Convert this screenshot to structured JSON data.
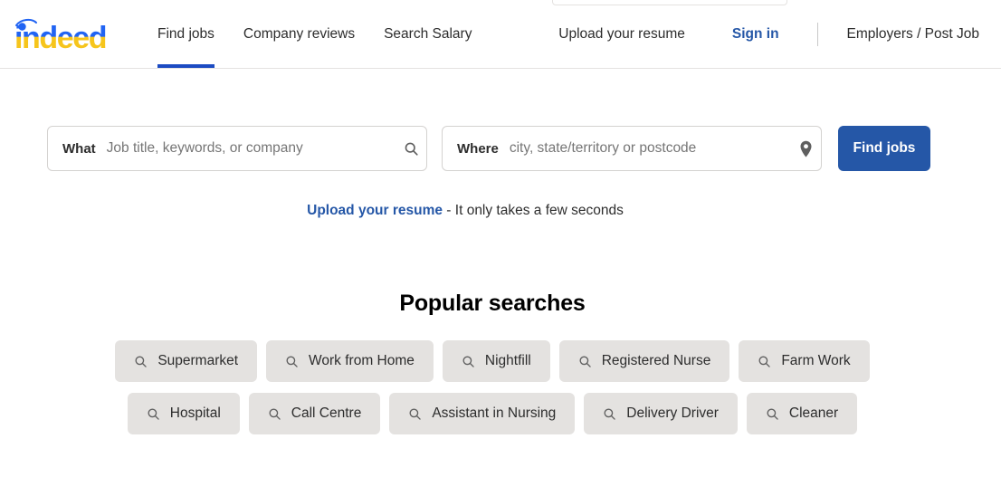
{
  "brand": {
    "logo_text": "indeed",
    "logo_blue": "#2164f3",
    "logo_yellow": "#f6c51c"
  },
  "header": {
    "nav_primary": [
      {
        "label": "Find jobs",
        "active": true
      },
      {
        "label": "Company reviews",
        "active": false
      },
      {
        "label": "Search Salary",
        "active": false
      }
    ],
    "upload_resume": "Upload your resume",
    "sign_in": "Sign in",
    "employers": "Employers / Post Job",
    "accent_color": "#2557a7",
    "active_underline_color": "#1c4bc2"
  },
  "search": {
    "what_label": "What",
    "what_placeholder": "Job title, keywords, or company",
    "what_value": "",
    "what_icon": "search-icon",
    "where_label": "Where",
    "where_placeholder": "city, state/territory or postcode",
    "where_value": "",
    "where_icon": "location-pin-icon",
    "find_jobs_button": "Find jobs",
    "button_color": "#2557a7"
  },
  "resume_promo": {
    "link_text": "Upload your resume",
    "rest_text": " - It only takes a few seconds"
  },
  "popular_searches": {
    "title": "Popular searches",
    "chip_icon": "search-icon",
    "chip_color": "#e4e2e0",
    "row1": [
      {
        "label": "Supermarket"
      },
      {
        "label": "Work from Home"
      },
      {
        "label": "Nightfill"
      },
      {
        "label": "Registered Nurse"
      },
      {
        "label": "Farm Work"
      }
    ],
    "row2": [
      {
        "label": "Hospital"
      },
      {
        "label": "Call Centre"
      },
      {
        "label": "Assistant in Nursing"
      },
      {
        "label": "Delivery Driver"
      },
      {
        "label": "Cleaner"
      }
    ]
  }
}
